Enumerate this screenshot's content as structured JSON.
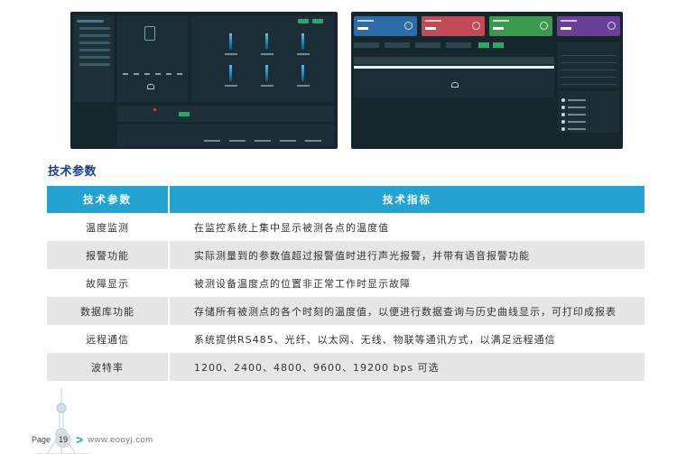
{
  "section_title": "技术参数",
  "table": {
    "headers": [
      "技术参数",
      "技术指标"
    ],
    "rows": [
      {
        "param": "温度监测",
        "spec": "在监控系统上集中显示被测各点的温度值"
      },
      {
        "param": "报警功能",
        "spec": "实际测量到的参数值超过报警值时进行声光报警，并带有语音报警功能"
      },
      {
        "param": "故障显示",
        "spec": "被测设备温度点的位置非正常工作时显示故障"
      },
      {
        "param": "数据库功能",
        "spec": "存储所有被测点的各个时刻的温度值，以便进行数据查询与历史曲线显示，可打印成报表"
      },
      {
        "param": "远程通信",
        "spec": "系统提供RS485、光纤、以太网、无线、物联等通讯方式，以满足远程通信"
      },
      {
        "param": "波特率",
        "spec": "1200、2400、4800、9600、19200 bps 可选"
      }
    ],
    "header_color": "#23a3d1",
    "stripe_color": "#e6e6e6"
  },
  "footer": {
    "page_label": "Page",
    "page_number": "19",
    "url": "www.eooyj.com"
  },
  "colors": {
    "title": "#1a3e92",
    "screenshot_bg": "#16262d",
    "card_blue": "#2b6da8",
    "card_red": "#c24a57",
    "card_green": "#3c9a4e",
    "card_purple": "#6a3f9a"
  }
}
